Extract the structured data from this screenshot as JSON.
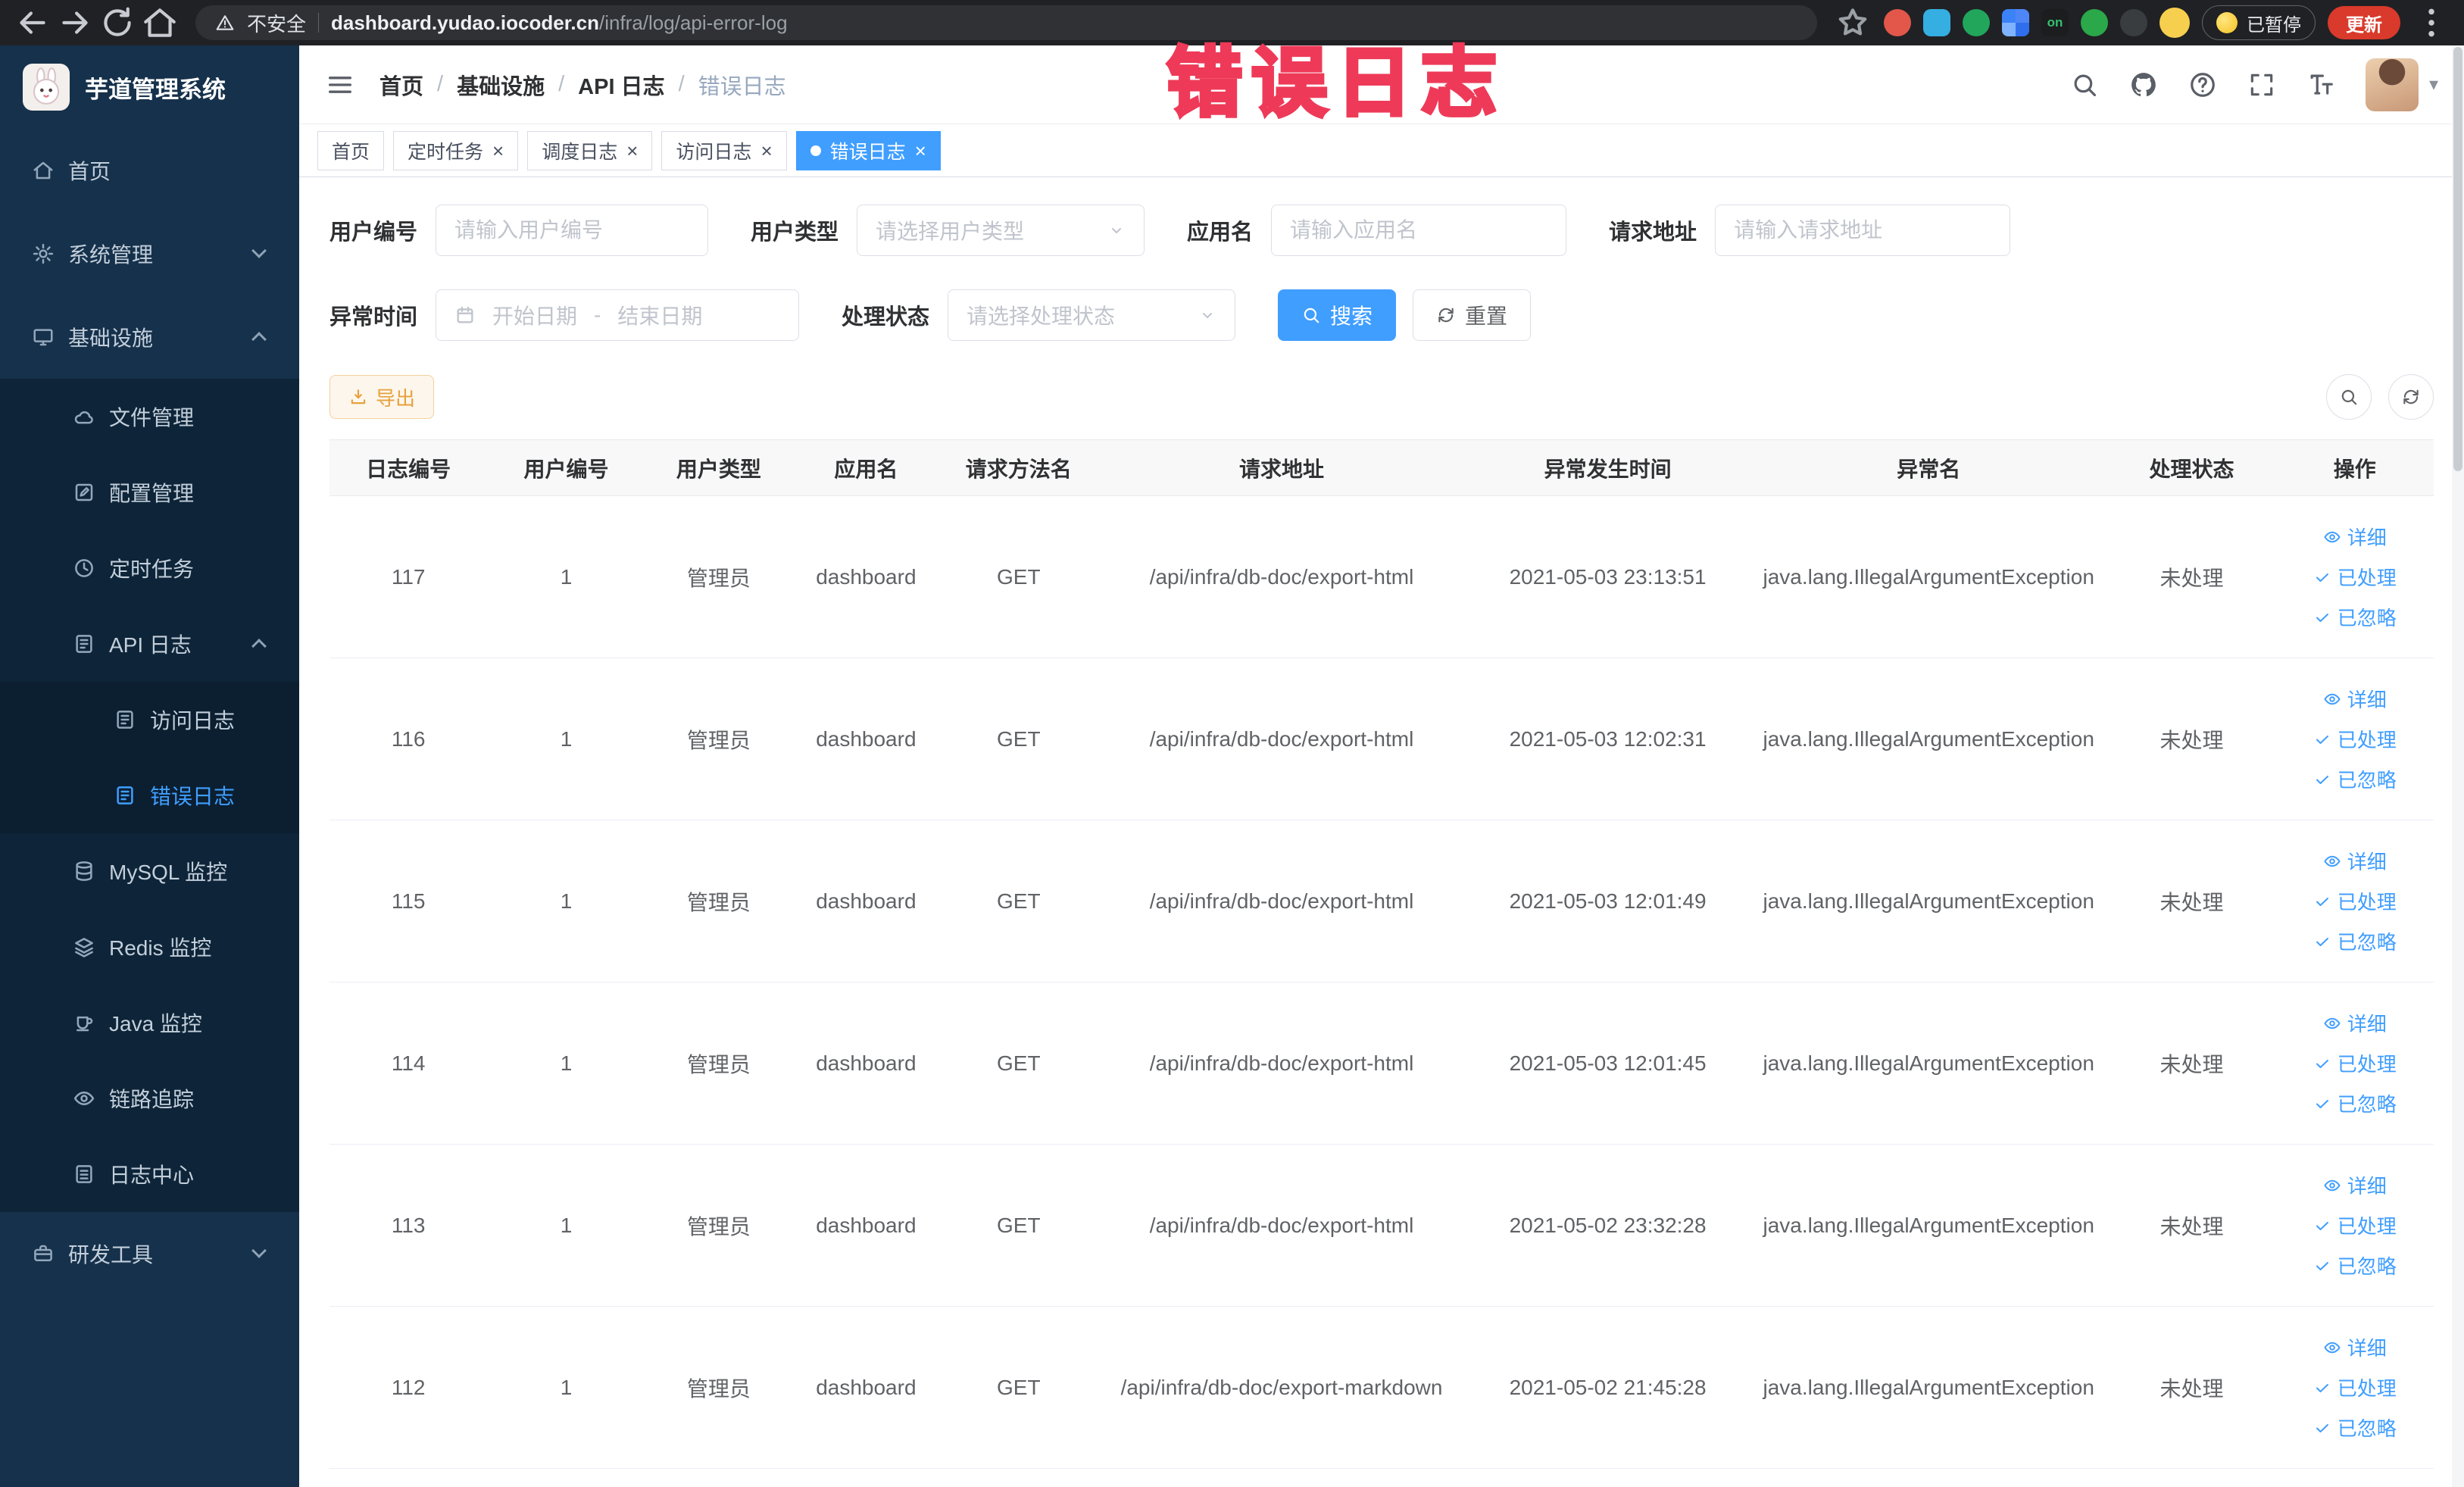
{
  "colors": {
    "accent": "#409eff",
    "warning": "#e6a23c",
    "watermark": "#ee3a58",
    "sidebar-bg": "#16314b",
    "submenu-bg": "#0e2539"
  },
  "browser": {
    "security_label": "不安全",
    "url_domain": "dashboard.yudao.iocoder.cn",
    "url_path": "/infra/log/api-error-log",
    "on_badge": "on",
    "paused_label": "已暂停",
    "update_label": "更新"
  },
  "sidebar": {
    "logo_title": "芋道管理系统",
    "menu": [
      {
        "key": "home",
        "label": "首页",
        "icon": "home-icon"
      },
      {
        "key": "system",
        "label": "系统管理",
        "icon": "gear-icon",
        "expandable": true,
        "expanded": false
      },
      {
        "key": "infra",
        "label": "基础设施",
        "icon": "infra-icon",
        "expandable": true,
        "expanded": true,
        "children": [
          {
            "key": "file",
            "label": "文件管理",
            "icon": "cloud-icon"
          },
          {
            "key": "config",
            "label": "配置管理",
            "icon": "config-icon"
          },
          {
            "key": "job",
            "label": "定时任务",
            "icon": "task-icon"
          },
          {
            "key": "api-log",
            "label": "API 日志",
            "icon": "log-icon",
            "expandable": true,
            "expanded": true,
            "children": [
              {
                "key": "api-access-log",
                "label": "访问日志",
                "icon": "log-icon"
              },
              {
                "key": "api-error-log",
                "label": "错误日志",
                "icon": "log-icon",
                "active": true
              }
            ]
          },
          {
            "key": "mysql",
            "label": "MySQL 监控",
            "icon": "mysql-icon"
          },
          {
            "key": "redis",
            "label": "Redis 监控",
            "icon": "redis-icon"
          },
          {
            "key": "java",
            "label": "Java 监控",
            "icon": "java-icon"
          },
          {
            "key": "trace",
            "label": "链路追踪",
            "icon": "trace-icon"
          },
          {
            "key": "log-center",
            "label": "日志中心",
            "icon": "logcenter-icon"
          }
        ]
      },
      {
        "key": "dev-tools",
        "label": "研发工具",
        "icon": "tool-icon",
        "expandable": true,
        "expanded": false
      }
    ]
  },
  "header": {
    "breadcrumb": [
      "首页",
      "基础设施",
      "API 日志",
      "错误日志"
    ],
    "icons": [
      "search-icon",
      "github-icon",
      "question-icon",
      "fullscreen-icon",
      "font-size-icon"
    ]
  },
  "tabs": [
    {
      "key": "home",
      "label": "首页",
      "closable": false,
      "active": false
    },
    {
      "key": "job",
      "label": "定时任务",
      "closable": true,
      "active": false
    },
    {
      "key": "job-log",
      "label": "调度日志",
      "closable": true,
      "active": false
    },
    {
      "key": "api-access-log",
      "label": "访问日志",
      "closable": true,
      "active": false
    },
    {
      "key": "api-error-log",
      "label": "错误日志",
      "closable": true,
      "active": true
    }
  ],
  "watermark": "错误日志",
  "filters": {
    "user_id": {
      "label": "用户编号",
      "placeholder": "请输入用户编号",
      "value": ""
    },
    "user_type": {
      "label": "用户类型",
      "placeholder": "请选择用户类型"
    },
    "app_name": {
      "label": "应用名",
      "placeholder": "请输入应用名",
      "value": ""
    },
    "request_url": {
      "label": "请求地址",
      "placeholder": "请输入请求地址",
      "value": ""
    },
    "exception_time": {
      "label": "异常时间",
      "start_placeholder": "开始日期",
      "separator": "-",
      "end_placeholder": "结束日期"
    },
    "process_status": {
      "label": "处理状态",
      "placeholder": "请选择处理状态"
    },
    "search_label": "搜索",
    "reset_label": "重置"
  },
  "toolbar": {
    "export_label": "导出"
  },
  "table": {
    "columns": [
      "日志编号",
      "用户编号",
      "用户类型",
      "应用名",
      "请求方法名",
      "请求地址",
      "异常发生时间",
      "异常名",
      "处理状态",
      "操作"
    ],
    "actions": [
      {
        "key": "detail",
        "label": "详细",
        "icon": "eye-icon"
      },
      {
        "key": "processed",
        "label": "已处理",
        "icon": "check-icon"
      },
      {
        "key": "ignored",
        "label": "已忽略",
        "icon": "check-icon"
      }
    ],
    "rows": [
      {
        "id": "117",
        "user_id": "1",
        "user_type": "管理员",
        "app": "dashboard",
        "method": "GET",
        "url": "/api/infra/db-doc/export-html",
        "time": "2021-05-03 23:13:51",
        "exception": "java.lang.IllegalArgumentException",
        "status": "未处理"
      },
      {
        "id": "116",
        "user_id": "1",
        "user_type": "管理员",
        "app": "dashboard",
        "method": "GET",
        "url": "/api/infra/db-doc/export-html",
        "time": "2021-05-03 12:02:31",
        "exception": "java.lang.IllegalArgumentException",
        "status": "未处理"
      },
      {
        "id": "115",
        "user_id": "1",
        "user_type": "管理员",
        "app": "dashboard",
        "method": "GET",
        "url": "/api/infra/db-doc/export-html",
        "time": "2021-05-03 12:01:49",
        "exception": "java.lang.IllegalArgumentException",
        "status": "未处理"
      },
      {
        "id": "114",
        "user_id": "1",
        "user_type": "管理员",
        "app": "dashboard",
        "method": "GET",
        "url": "/api/infra/db-doc/export-html",
        "time": "2021-05-03 12:01:45",
        "exception": "java.lang.IllegalArgumentException",
        "status": "未处理"
      },
      {
        "id": "113",
        "user_id": "1",
        "user_type": "管理员",
        "app": "dashboard",
        "method": "GET",
        "url": "/api/infra/db-doc/export-html",
        "time": "2021-05-02 23:32:28",
        "exception": "java.lang.IllegalArgumentException",
        "status": "未处理"
      },
      {
        "id": "112",
        "user_id": "1",
        "user_type": "管理员",
        "app": "dashboard",
        "method": "GET",
        "url": "/api/infra/db-doc/export-markdown",
        "time": "2021-05-02 21:45:28",
        "exception": "java.lang.IllegalArgumentException",
        "status": "未处理"
      }
    ]
  }
}
